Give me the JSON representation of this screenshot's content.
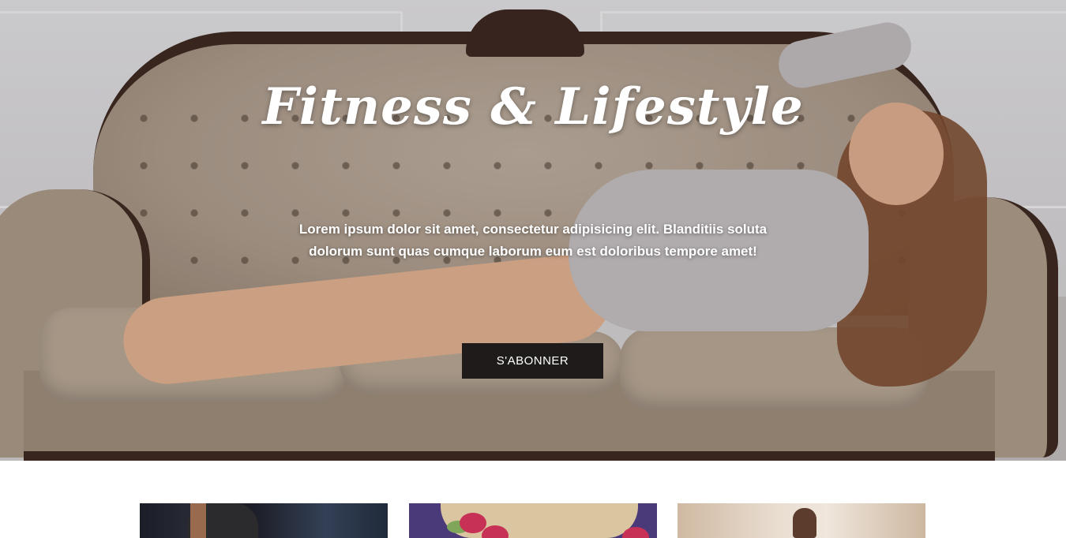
{
  "hero": {
    "title": "Fitness & Lifestyle",
    "text": "Lorem ipsum dolor sit amet, consectetur adipisicing elit. Blanditiis soluta dolorum sunt quas cumque laborum eum est doloribus tempore amet!",
    "cta_label": "S'ABONNER"
  },
  "colors": {
    "button_bg": "#1e1b1a",
    "text": "#ffffff",
    "page_bg": "#ffffff"
  }
}
